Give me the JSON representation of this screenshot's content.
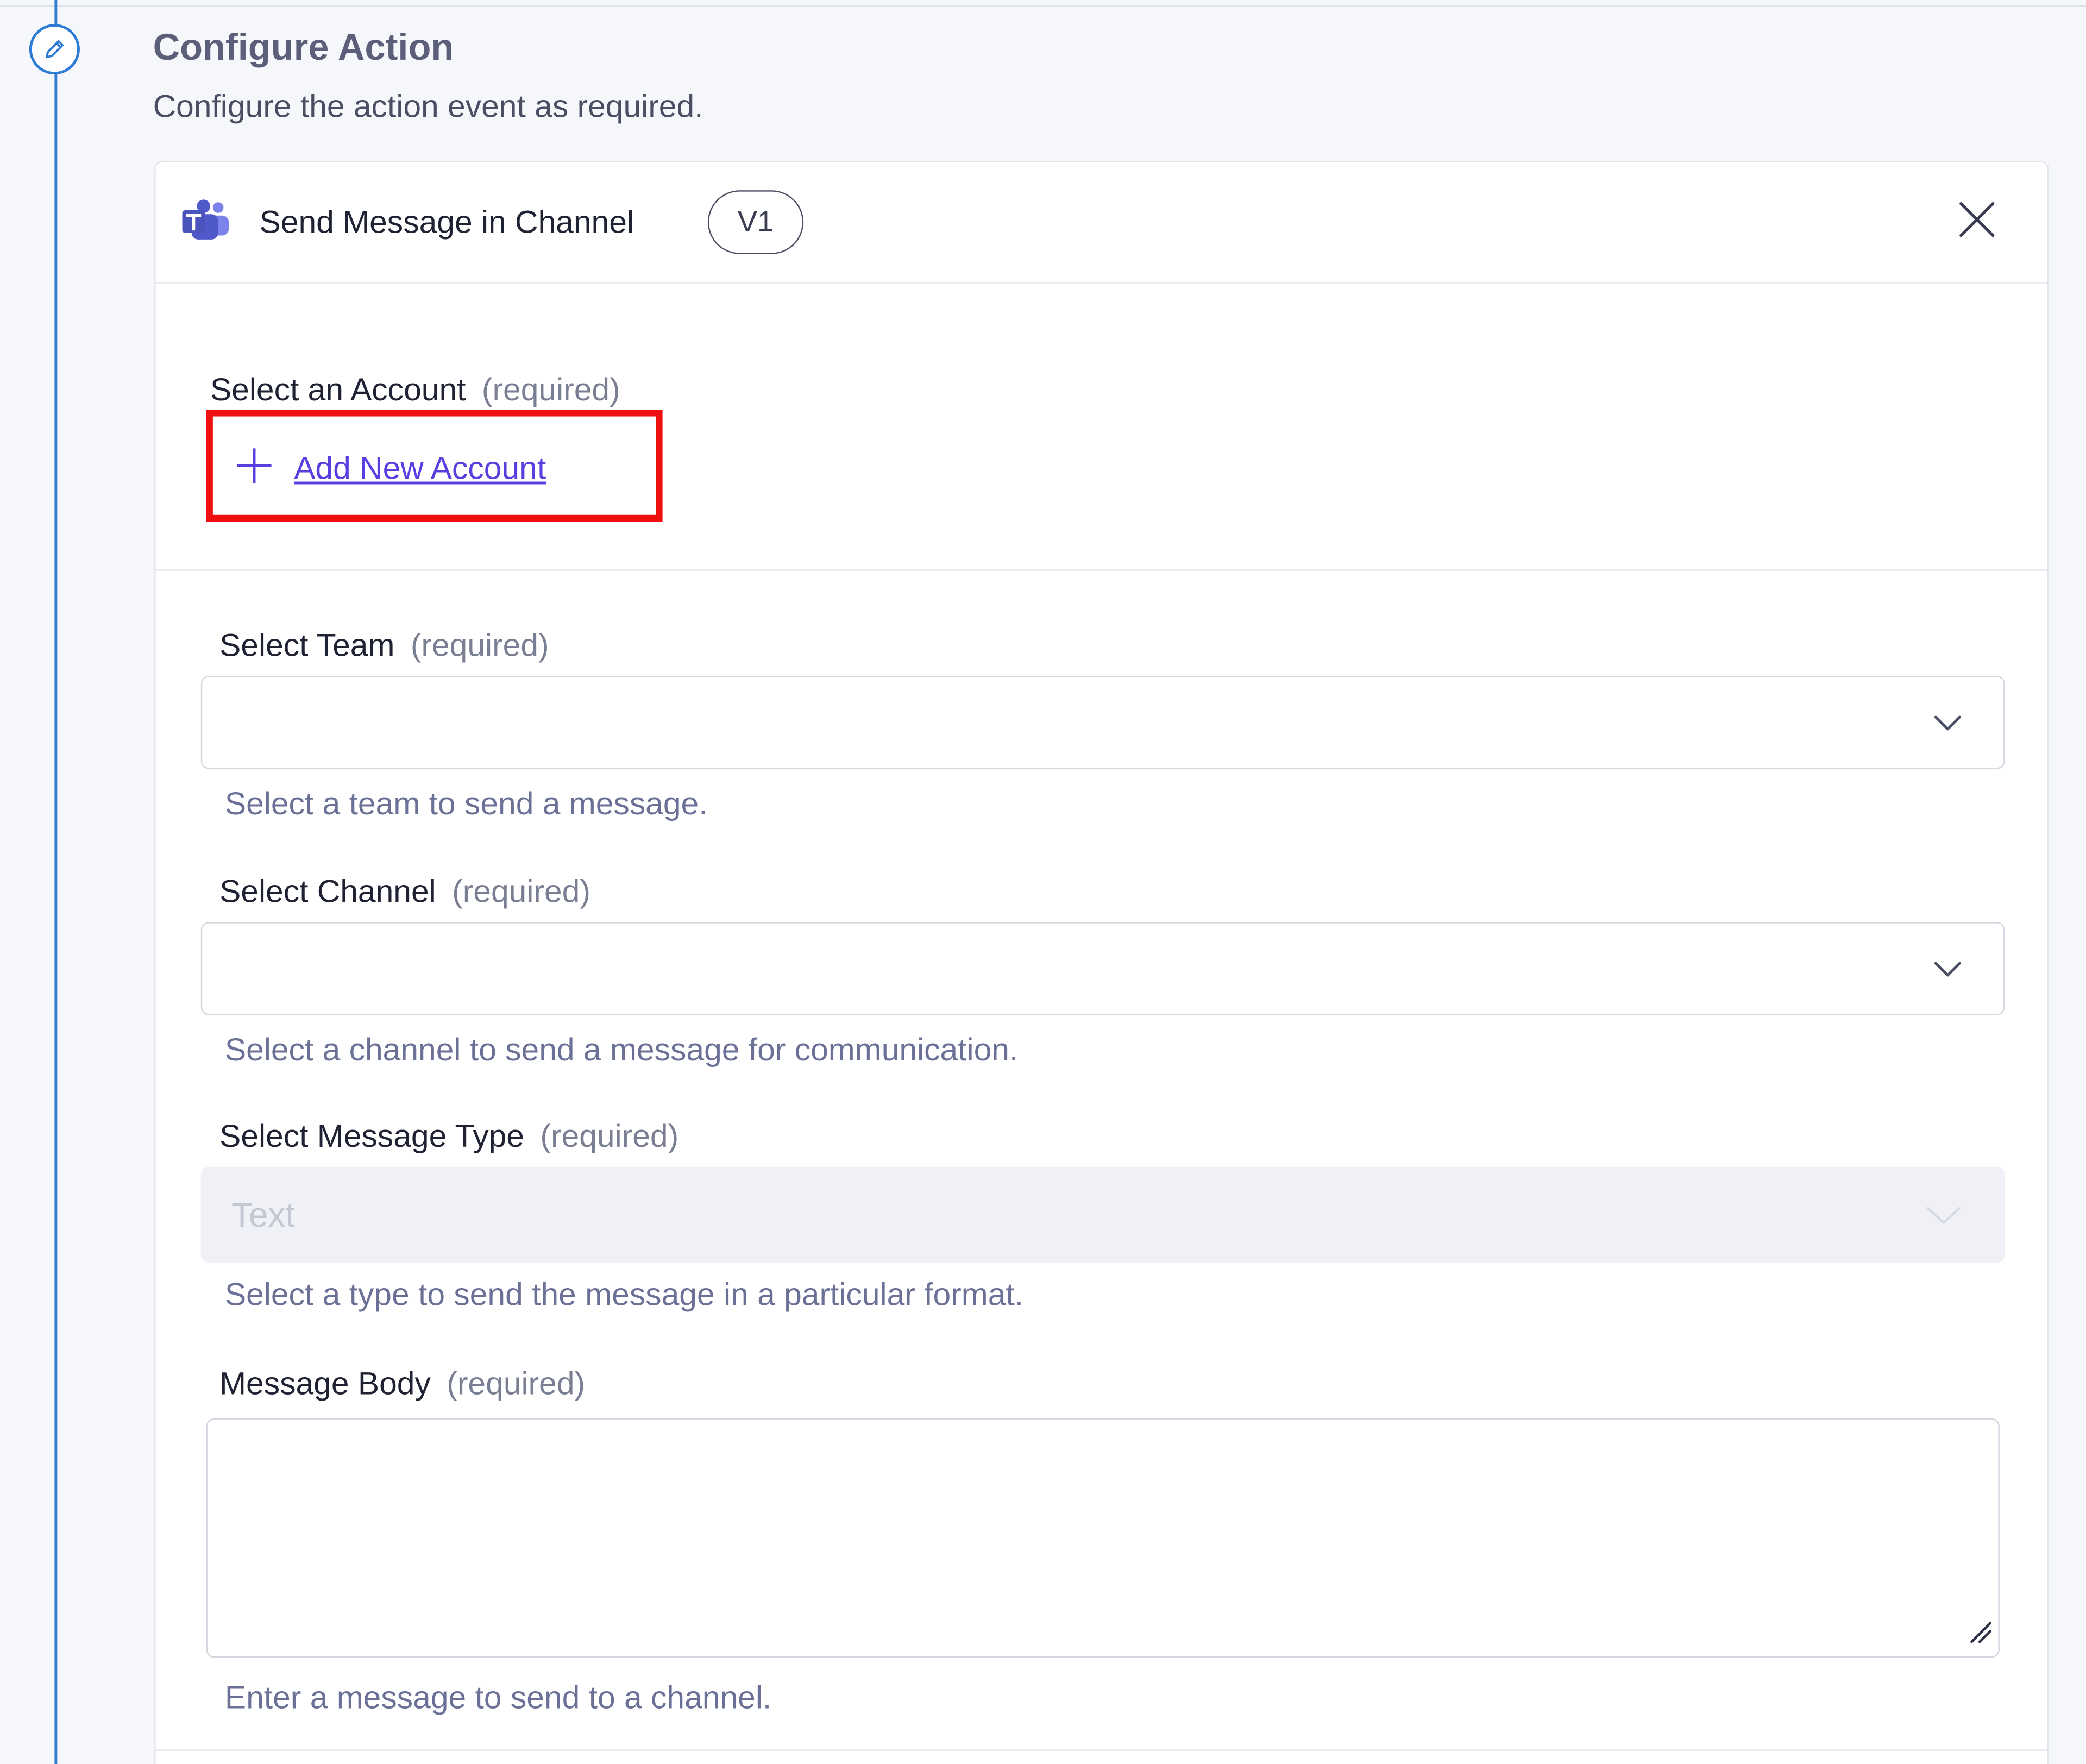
{
  "section": {
    "title": "Configure Action",
    "subtitle": "Configure the action event as required."
  },
  "action": {
    "title": "Send Message in Channel",
    "version": "V1"
  },
  "account": {
    "label": "Select an Account",
    "required": "(required)",
    "add_link": "Add New Account"
  },
  "fields": {
    "team": {
      "label": "Select Team",
      "required": "(required)",
      "value": "",
      "hint": "Select a team to send a message."
    },
    "channel": {
      "label": "Select Channel",
      "required": "(required)",
      "value": "",
      "hint": "Select a channel to send a message for communication."
    },
    "message_type": {
      "label": "Select Message Type",
      "required": "(required)",
      "value": "Text",
      "hint": "Select a type to send the message in a particular format."
    },
    "message_body": {
      "label": "Message Body",
      "required": "(required)",
      "value": "",
      "hint": "Enter a message to send to a channel."
    }
  },
  "icons": {
    "step": "pencil-icon",
    "app": "microsoft-teams-icon",
    "close": "close-icon",
    "add": "plus-icon",
    "dropdown": "chevron-down-icon",
    "resize": "resize-handle-icon"
  },
  "colors": {
    "accent": "#2e7bd6",
    "link": "#5a3fe0",
    "highlight": "#ee0f0f",
    "teams": "#5059c9"
  }
}
